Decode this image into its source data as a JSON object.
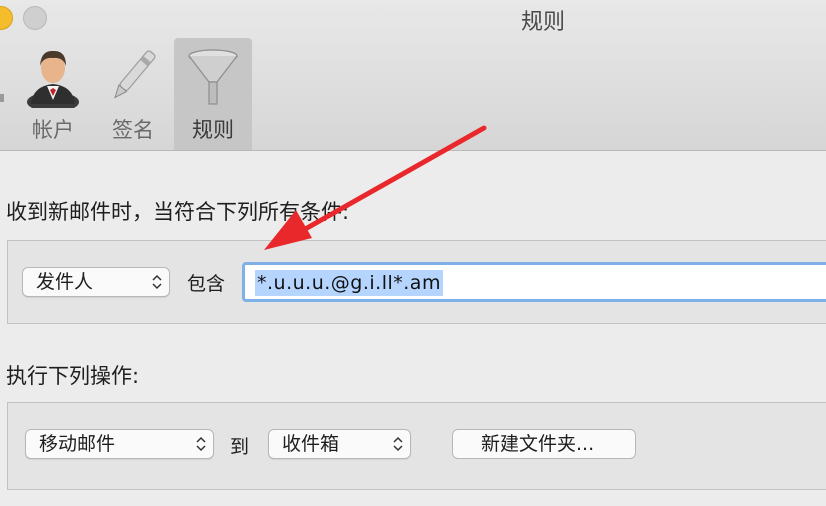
{
  "window": {
    "title": "规则"
  },
  "toolbar": {
    "items": [
      {
        "label": "帐户",
        "icon": "user-account-icon"
      },
      {
        "label": "签名",
        "icon": "pen-icon"
      },
      {
        "label": "规则",
        "icon": "funnel-icon",
        "selected": true
      }
    ]
  },
  "conditions": {
    "heading": "收到新邮件时，当符合下列所有条件:",
    "field_select": "发件人",
    "operator": "包含",
    "value": "*.u.u.u.@g.i.ll*.am"
  },
  "actions": {
    "heading": "执行下列操作:",
    "action_select": "移动邮件",
    "to_label": "到",
    "mailbox_select": "收件箱",
    "new_folder_button": "新建文件夹..."
  },
  "colors": {
    "annotation_arrow": "#e8282b",
    "selection_highlight": "#b5d5ff",
    "focus_ring": "#7fb0e8"
  }
}
